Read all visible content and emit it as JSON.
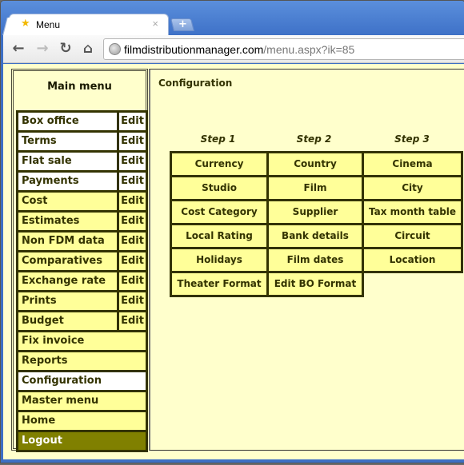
{
  "browser": {
    "tab_title": "Menu",
    "tab_close": "×",
    "new_tab": "+",
    "url_domain": "filmdistributionmanager.com",
    "url_path": "/menu.aspx?ik=85",
    "icons": {
      "favicon": "★",
      "back": "←",
      "forward": "→",
      "reload": "↻",
      "home": "⌂"
    }
  },
  "sidebar": {
    "title": "Main menu",
    "items": [
      {
        "label": "Box office",
        "edit": "Edit",
        "style": "white"
      },
      {
        "label": "Terms",
        "edit": "Edit",
        "style": "white"
      },
      {
        "label": "Flat sale",
        "edit": "Edit",
        "style": "white"
      },
      {
        "label": "Payments",
        "edit": "Edit",
        "style": "white"
      },
      {
        "label": "Cost",
        "edit": "Edit",
        "style": "yellow"
      },
      {
        "label": "Estimates",
        "edit": "Edit",
        "style": "yellow"
      },
      {
        "label": "Non FDM data",
        "edit": "Edit",
        "style": "yellow"
      },
      {
        "label": "Comparatives",
        "edit": "Edit",
        "style": "yellow"
      },
      {
        "label": "Exchange rate",
        "edit": "Edit",
        "style": "yellow"
      },
      {
        "label": "Prints",
        "edit": "Edit",
        "style": "yellow"
      },
      {
        "label": "Budget",
        "edit": "Edit",
        "style": "yellow"
      },
      {
        "label": "Fix invoice",
        "style": "yellow"
      },
      {
        "label": "Reports",
        "style": "yellow"
      },
      {
        "label": "Configuration",
        "style": "white",
        "selected": true
      },
      {
        "label": "Master menu",
        "style": "yellow"
      },
      {
        "label": "Home",
        "style": "yellow"
      },
      {
        "label": "Logout",
        "style": "logout"
      }
    ]
  },
  "main": {
    "title": "Configuration",
    "steps": [
      "Step 1",
      "Step 2",
      "Step 3"
    ],
    "grid": [
      [
        "Currency",
        "Country",
        "Cinema"
      ],
      [
        "Studio",
        "Film",
        "City"
      ],
      [
        "Cost Category",
        "Supplier",
        "Tax month table"
      ],
      [
        "Local Rating",
        "Bank details",
        "Circuit"
      ],
      [
        "Holidays",
        "Film dates",
        "Location"
      ],
      [
        "Theater Format",
        "Edit BO Format",
        ""
      ]
    ]
  },
  "colors": {
    "page_bg": "#ffffcc",
    "cell_bg": "#ffff99",
    "border": "#333300",
    "logout_bg": "#808000",
    "titlebar": "#4a7fd0"
  }
}
